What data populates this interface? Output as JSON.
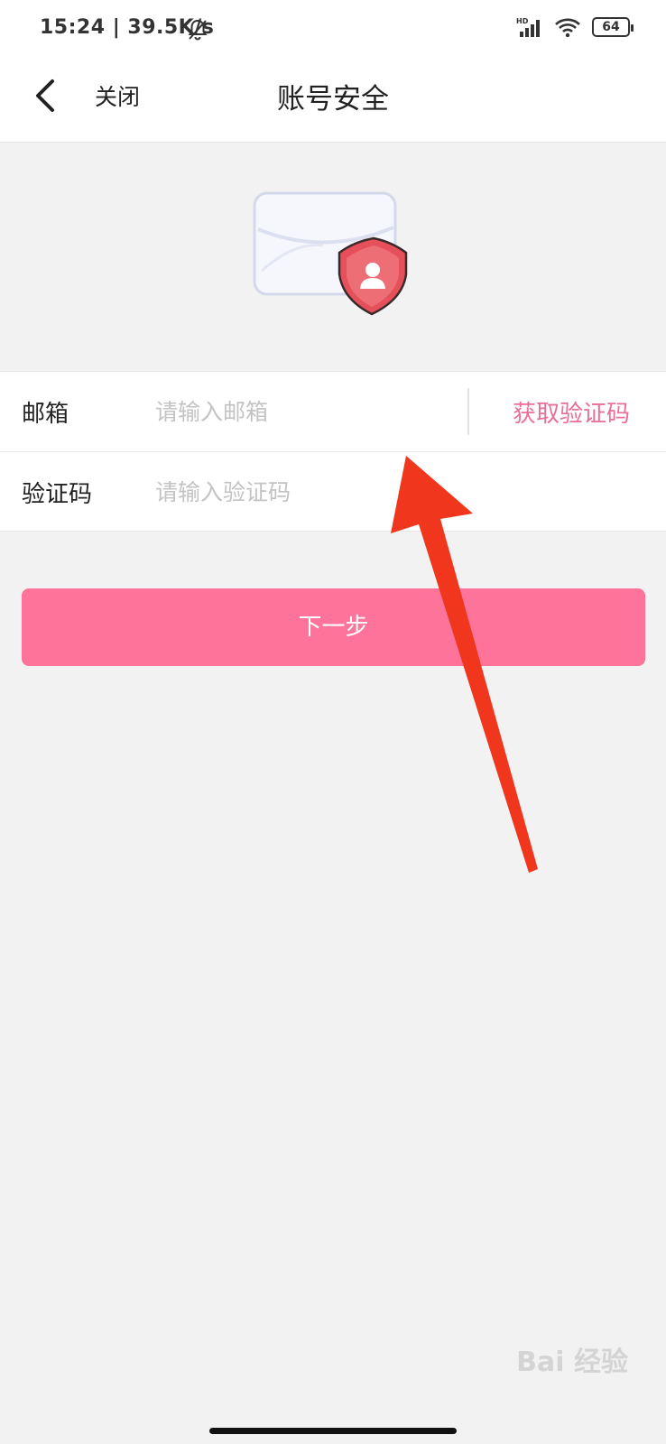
{
  "status_bar": {
    "time": "15:24 | 39.5K/s",
    "network_badge": "HD",
    "battery": "64",
    "icons": [
      "mute-bell-icon",
      "signal-icon",
      "wifi-icon",
      "battery-icon"
    ]
  },
  "nav": {
    "back_icon": "chevron-left-icon",
    "close_label": "关闭",
    "title": "账号安全"
  },
  "hero": {
    "icon": "envelope-shield-icon"
  },
  "form": {
    "email": {
      "label": "邮箱",
      "placeholder": "请输入邮箱",
      "value": ""
    },
    "get_code_label": "获取验证码",
    "code": {
      "label": "验证码",
      "placeholder": "请输入验证码",
      "value": ""
    }
  },
  "next_button_label": "下一步",
  "overlay": {
    "arrow_color": "#f0361d",
    "icon": "annotation-arrow-icon"
  },
  "watermark": "Bai 经验",
  "colors": {
    "accent": "#fd7399",
    "link": "#ea6f97",
    "background": "#f2f2f3"
  }
}
